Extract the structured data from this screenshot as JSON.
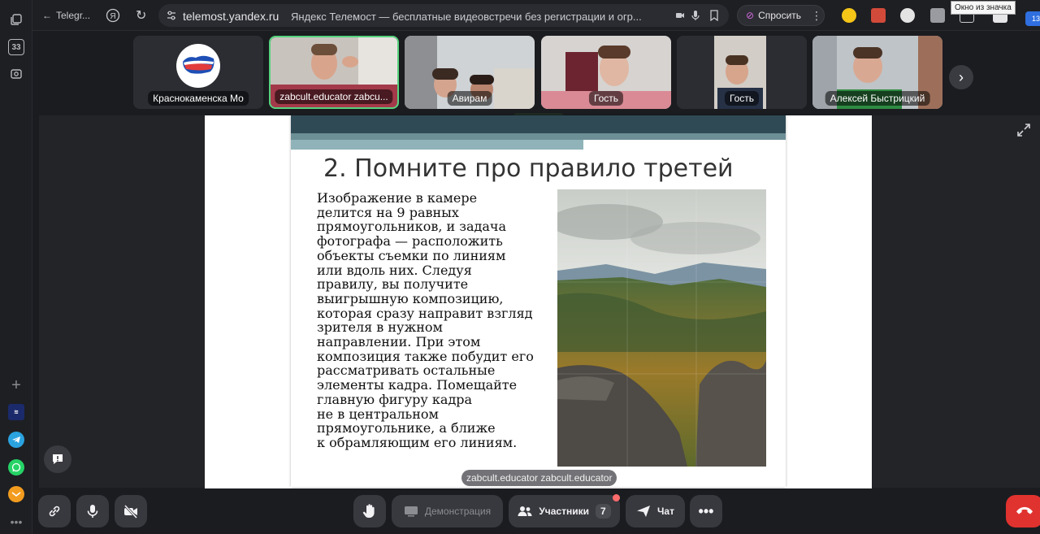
{
  "browser": {
    "back_tab_label": "Telegr...",
    "domain": "telemost.yandex.ru",
    "page_title": "Яндекс Телемост — бесплатные видеовстречи без регистрации и огр...",
    "ask_button": "Спросить",
    "tooltip": "Окно из значка",
    "sidebar_badge": "33",
    "notif_count": "13"
  },
  "participants": [
    {
      "name": "Краснокаменска Мо"
    },
    {
      "name": "zabcult.educator zabcu..."
    },
    {
      "name": "Авирам"
    },
    {
      "name": "Гость"
    },
    {
      "name": "Гость"
    },
    {
      "name": "Алексей Быстрицкий"
    }
  ],
  "slide": {
    "title": "2. Помните про правило третей",
    "body_lines": [
      "Изображение в камере",
      "делится на 9 равных",
      "прямоугольников, и задача",
      "фотографа — расположить",
      "объекты съемки по линиям",
      "или вдоль них. Следуя",
      "правилу, вы получите",
      "выигрышную композицию,",
      "которая сразу направит взгляд",
      "зрителя в нужном",
      "направлении. При этом",
      "композиция также побудит его",
      "рассматривать остальные",
      "элементы кадра. Помещайте",
      "главную фигуру кадра",
      "не в центральном",
      "прямоугольнике, а ближе",
      "к обрамляющим его линиям."
    ]
  },
  "presenter_label": "zabcult.educator zabcult.educator",
  "controls": {
    "demo_label": "Демонстрация",
    "participants_label": "Участники",
    "participants_count": "7",
    "chat_label": "Чат"
  }
}
